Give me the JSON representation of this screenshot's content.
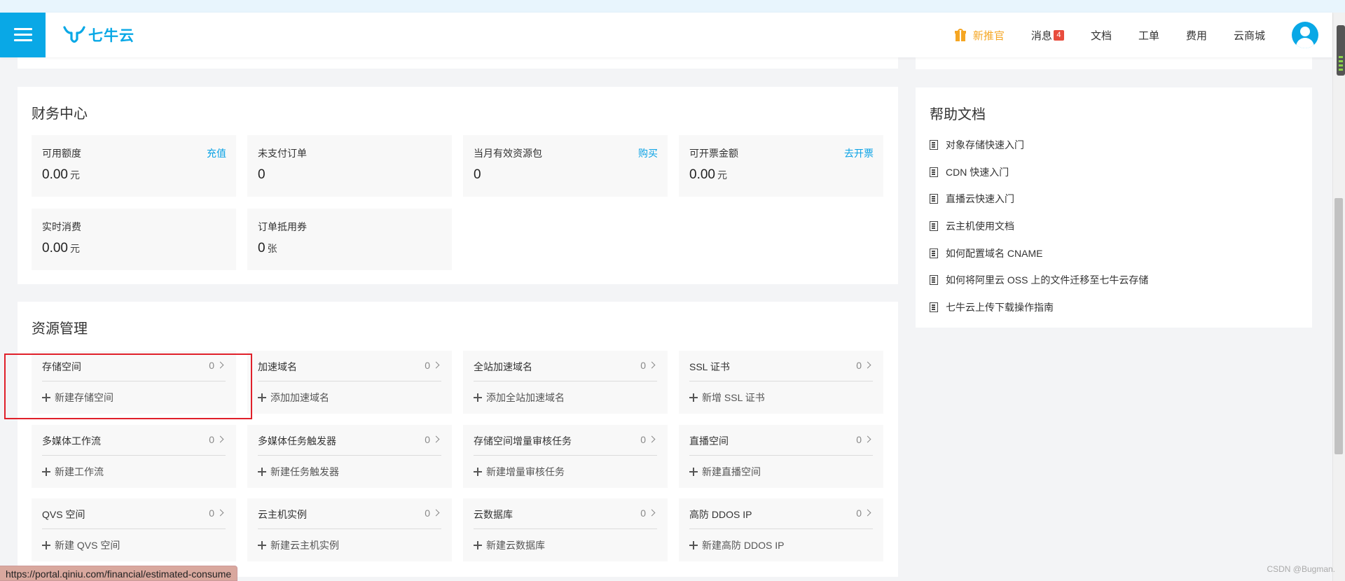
{
  "header": {
    "logo_text": "七牛云",
    "nav": {
      "promo": "新推官",
      "messages": "消息",
      "messages_badge": "4",
      "docs": "文档",
      "tickets": "工单",
      "billing": "费用",
      "store": "云商城"
    }
  },
  "finance": {
    "title": "财务中心",
    "available": {
      "label": "可用额度",
      "link": "充值",
      "value": "0.00",
      "unit": "元"
    },
    "unpaid": {
      "label": "未支付订单",
      "value": "0"
    },
    "packages": {
      "label": "当月有效资源包",
      "link": "购买",
      "value": "0"
    },
    "invoice": {
      "label": "可开票金额",
      "link": "去开票",
      "value": "0.00",
      "unit": "元"
    },
    "realtime": {
      "label": "实时消费",
      "value": "0.00",
      "unit": "元"
    },
    "coupons": {
      "label": "订单抵用券",
      "value": "0",
      "unit": "张"
    }
  },
  "resources": {
    "title": "资源管理",
    "items": [
      {
        "name": "存储空间",
        "count": "0",
        "add": "新建存储空间"
      },
      {
        "name": "加速域名",
        "count": "0",
        "add": "添加加速域名"
      },
      {
        "name": "全站加速域名",
        "count": "0",
        "add": "添加全站加速域名"
      },
      {
        "name": "SSL 证书",
        "count": "0",
        "add": "新增 SSL 证书"
      },
      {
        "name": "多媒体工作流",
        "count": "0",
        "add": "新建工作流"
      },
      {
        "name": "多媒体任务触发器",
        "count": "0",
        "add": "新建任务触发器"
      },
      {
        "name": "存储空间增量审核任务",
        "count": "0",
        "add": "新建增量审核任务"
      },
      {
        "name": "直播空间",
        "count": "0",
        "add": "新建直播空间"
      },
      {
        "name": "QVS 空间",
        "count": "0",
        "add": "新建 QVS 空间"
      },
      {
        "name": "云主机实例",
        "count": "0",
        "add": "新建云主机实例"
      },
      {
        "name": "云数据库",
        "count": "0",
        "add": "新建云数据库"
      },
      {
        "name": "高防 DDOS IP",
        "count": "0",
        "add": "新建高防 DDOS IP"
      }
    ]
  },
  "help": {
    "title": "帮助文档",
    "items": [
      "对象存储快速入门",
      "CDN 快速入门",
      "直播云快速入门",
      "云主机使用文档",
      "如何配置域名 CNAME",
      "如何将阿里云 OSS 上的文件迁移至七牛云存储",
      "七牛云上传下载操作指南"
    ]
  },
  "status_url": "https://portal.qiniu.com/financial/estimated-consume",
  "watermark": "CSDN @Bugman.",
  "colors": {
    "brand": "#09a8e6",
    "link": "#0aa2e5",
    "promo": "#f5a623",
    "badge": "#e84c3d",
    "highlight": "#e0202a"
  }
}
